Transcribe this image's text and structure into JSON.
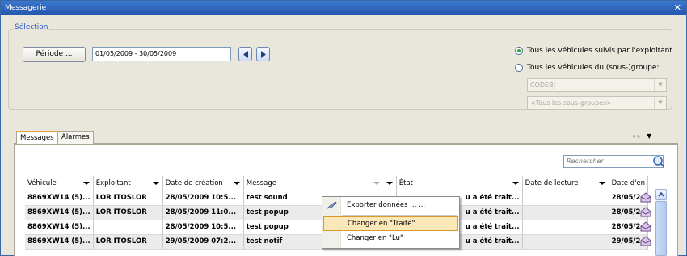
{
  "window": {
    "title": "Messagerie",
    "close": "✕"
  },
  "selection": {
    "legend": "Sélection",
    "periode_button": "Période ...",
    "date_range": "01/05/2009 - 30/05/2009",
    "radio_all": "Tous les véhicules suivis par l'exploitant",
    "radio_group": "Tous les véhicules du (sous-)groupe:",
    "group_combo": "CODEBJ",
    "subgroup_combo": "<Tous les sous-groupes>"
  },
  "tabs": [
    {
      "label": "Messages",
      "active": true
    },
    {
      "label": "Alarmes",
      "active": false
    }
  ],
  "tabnav": {
    "prev": "◂",
    "next": "▸"
  },
  "search": {
    "placeholder": "Rechercher"
  },
  "table": {
    "headers": [
      "Véhicule",
      "Exploitant",
      "Date de création",
      "Message",
      "État",
      "Date de lecture",
      "Date d'en"
    ],
    "rows": [
      [
        "8869XW14  (5)...",
        "LOR ITOSLOR",
        "28/05/2009 10:5...",
        "test sound",
        "u a été trait...",
        "",
        "28/05/2"
      ],
      [
        "8869XW14  (5)...",
        "LOR ITOSLOR",
        "28/05/2009 11:0...",
        "test popup",
        "u a été trait...",
        "",
        "28/05/2"
      ],
      [
        "8869XW14  (5)...",
        "",
        "28/05/2009 10:5...",
        "test popup",
        "u a été trait...",
        "",
        "28/05/2"
      ],
      [
        "8869XW14  (5)...",
        "LOR ITOSLOR",
        "29/05/2009 07:2...",
        "test notif",
        "u a été trait...",
        "",
        "29/05/2"
      ]
    ]
  },
  "context_menu": {
    "items": [
      "Exporter données ... ...",
      "Changer en \"Traité\"",
      "Changer en \"Lu\""
    ]
  },
  "colors": {
    "accent": "#2456ab",
    "highlight": "#fbe8b8",
    "radio_selected": "#2fa82f"
  }
}
